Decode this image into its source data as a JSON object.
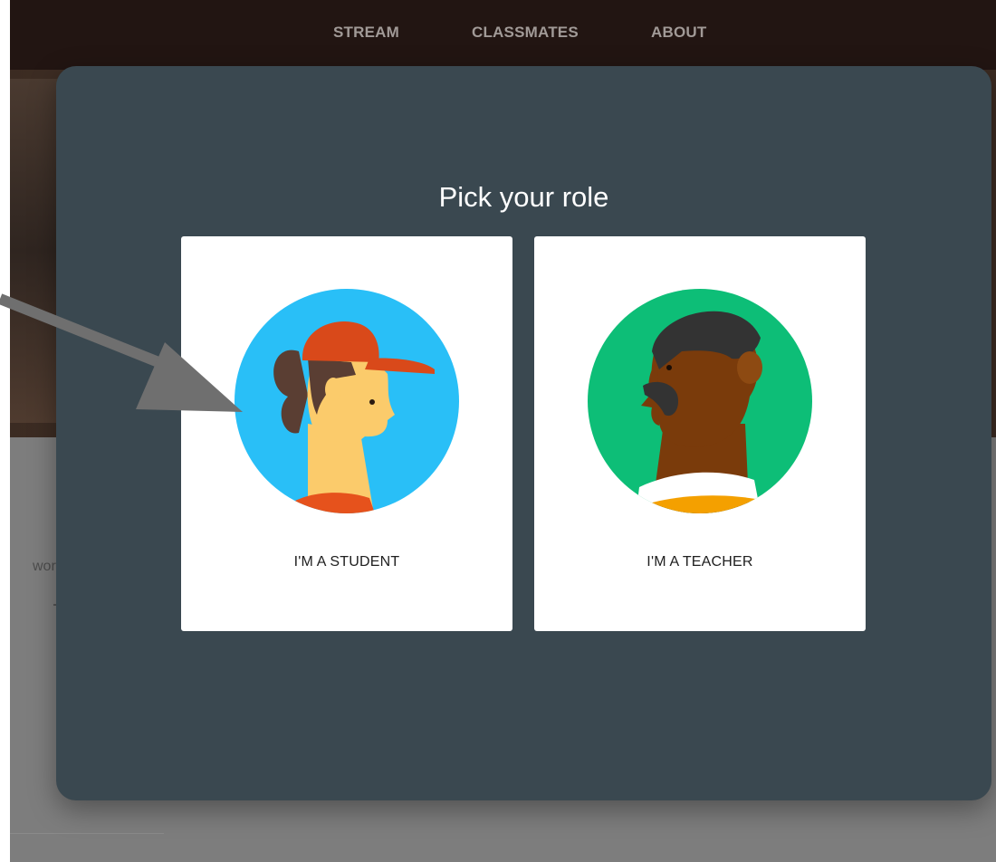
{
  "nav": {
    "tabs": [
      {
        "label": "STREAM"
      },
      {
        "label": "CLASSMATES"
      },
      {
        "label": "ABOUT"
      }
    ]
  },
  "background": {
    "partial_text": "work c"
  },
  "dialog": {
    "title": "Pick your role",
    "roles": [
      {
        "label": "I'M A STUDENT",
        "avatar_icon": "student-avatar-icon",
        "color": "#29bff7"
      },
      {
        "label": "I'M A TEACHER",
        "avatar_icon": "teacher-avatar-icon",
        "color": "#0dbe77"
      }
    ]
  },
  "annotation": {
    "icon": "pointer-arrow-icon",
    "color": "#6f6f6f"
  }
}
